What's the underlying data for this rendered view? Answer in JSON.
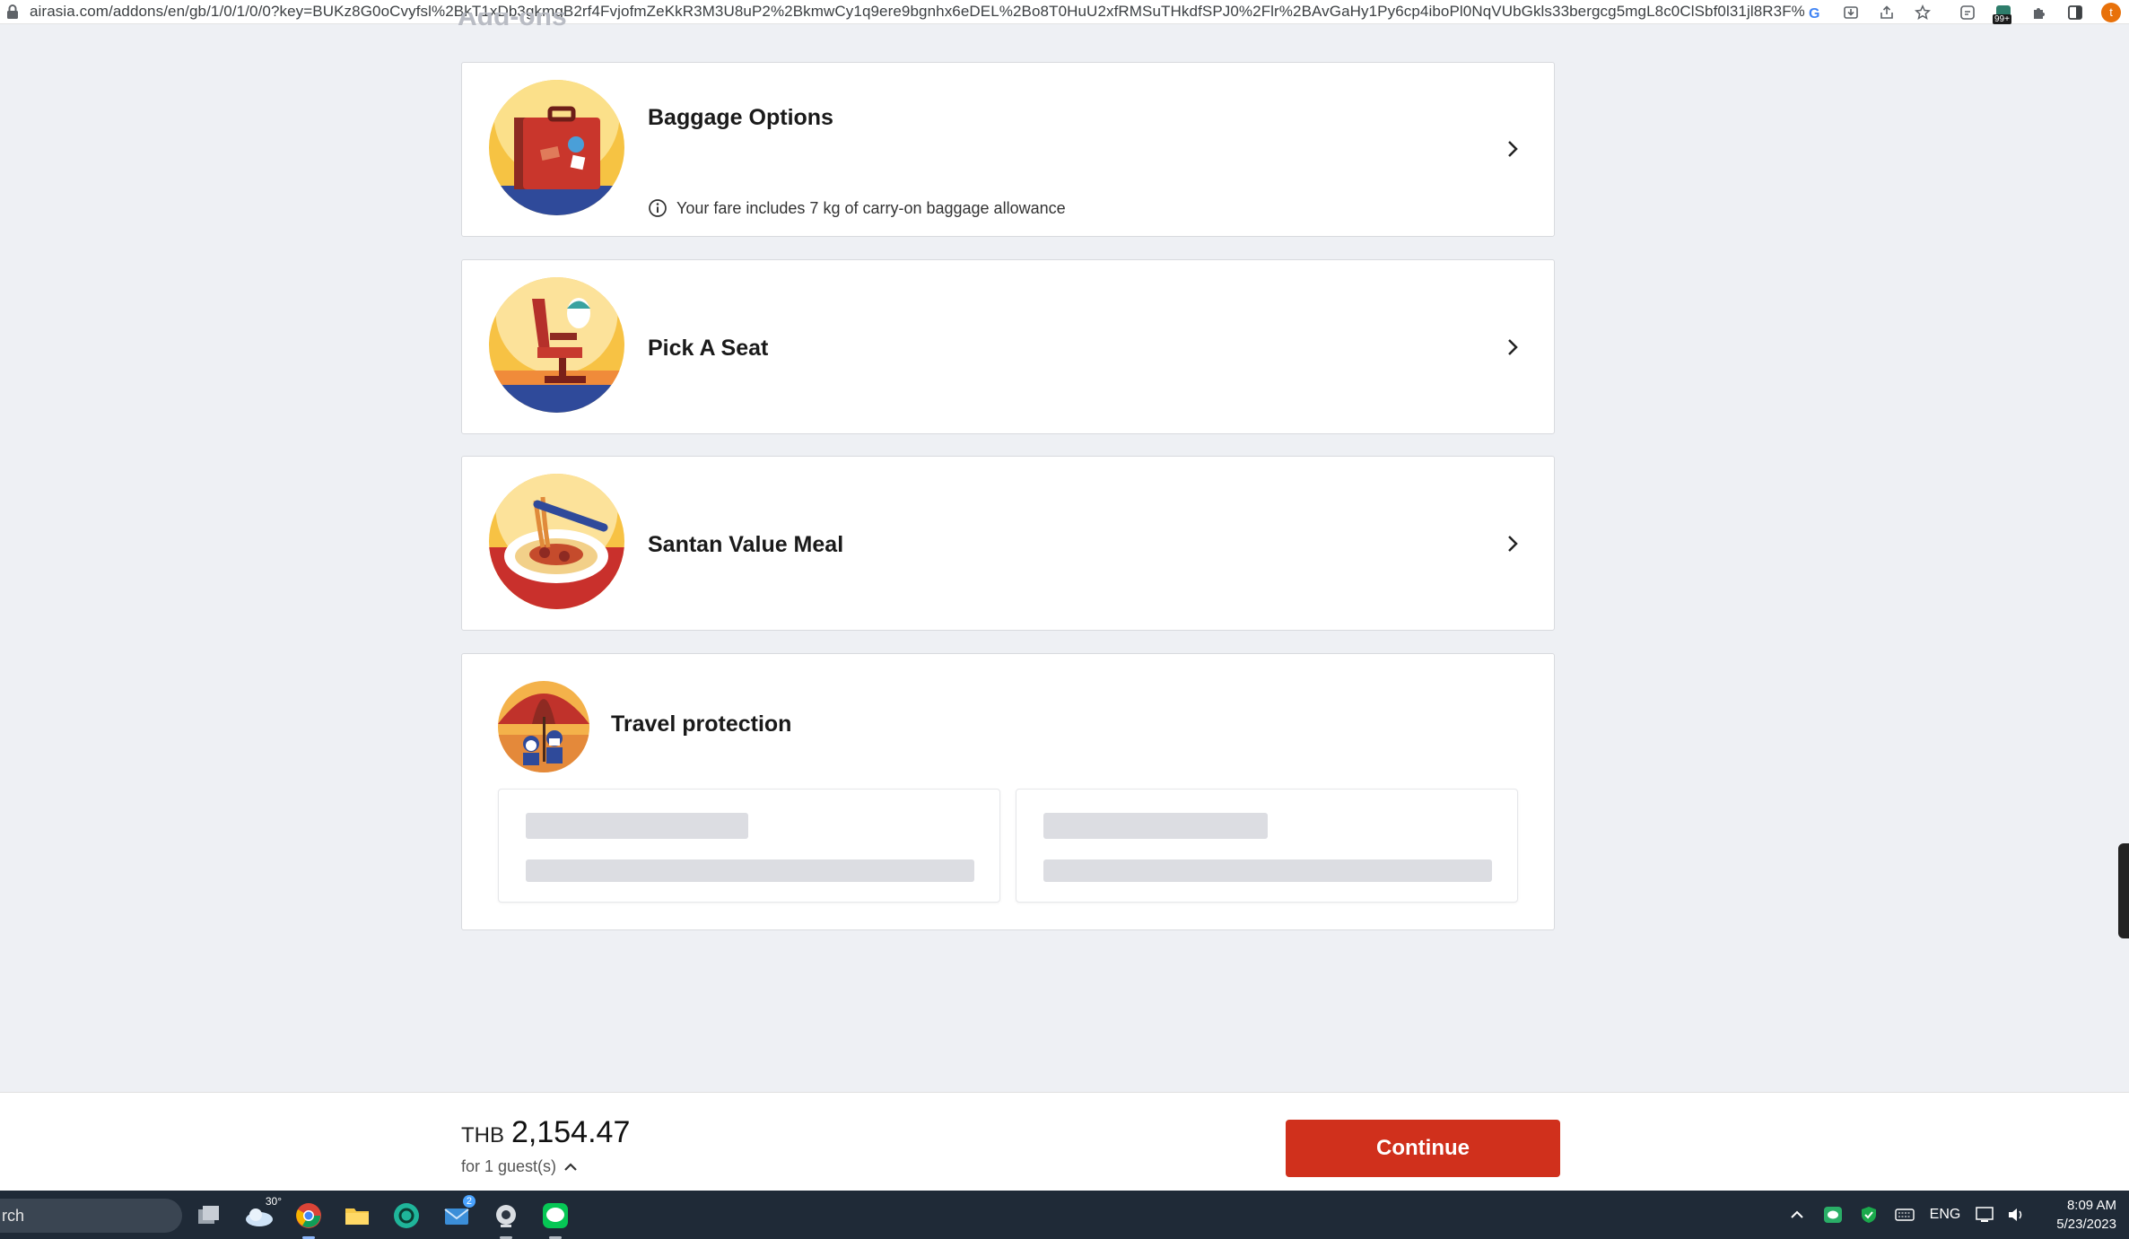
{
  "browser": {
    "url": "airasia.com/addons/en/gb/1/0/1/0/0?key=BUKz8G0oCvyfsl%2BkT1xDb3gkmgB2rf4FvjofmZeKkR3M3U8uP2%2BkmwCy1q9ere9bgnhx6eDEL%2Bo8T0HuU2xfRMSuTHkdfSPJ0%2Flr%2BAvGaHy1Py6cp4iboPl0NqVUbGkls33bergcg5mgL8c0ClSbf0l31jl8R3F%...",
    "profile_initial": "t",
    "extension_badge": "99+"
  },
  "page": {
    "section_heading_partial": "Add-ons"
  },
  "addons": [
    {
      "title": "Baggage Options",
      "note": "Your fare includes 7 kg of carry-on baggage allowance"
    },
    {
      "title": "Pick A Seat"
    },
    {
      "title": "Santan Value Meal"
    }
  ],
  "protection": {
    "title": "Travel protection"
  },
  "footer": {
    "currency": "THB",
    "amount": "2,154.47",
    "guests": "for 1 guest(s)",
    "continue_label": "Continue"
  },
  "taskbar": {
    "search_text": "rch",
    "weather_temp": "30°",
    "mail_badge": "2",
    "language": "ENG",
    "time": "8:09 AM",
    "date": "5/23/2023"
  },
  "colors": {
    "accent": "#d0301c",
    "page_bg": "#eef0f4",
    "taskbar": "#1f2a37"
  }
}
